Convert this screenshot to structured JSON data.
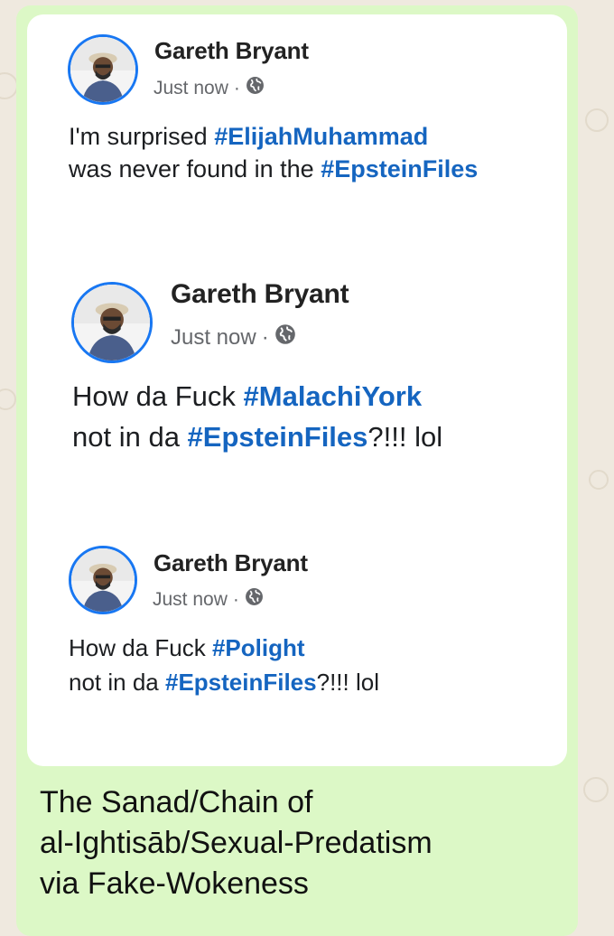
{
  "message": {
    "posts": [
      {
        "author": "Gareth Bryant",
        "time": "Just now",
        "separator": "·",
        "line1_text": "I'm surprised ",
        "line1_tag": "#ElijahMuhammad",
        "line2_text": "was never found in the ",
        "line2_tag": "#EpsteinFiles",
        "line2_suffix": ""
      },
      {
        "author": "Gareth Bryant",
        "time": "Just now",
        "separator": "·",
        "line1_text": "How da Fuck ",
        "line1_tag": "#MalachiYork",
        "line2_text": "not in da ",
        "line2_tag": "#EpsteinFiles",
        "line2_suffix": "?!!! lol"
      },
      {
        "author": "Gareth Bryant",
        "time": "Just now",
        "separator": "·",
        "line1_text": "How da Fuck ",
        "line1_tag": "#Polight",
        "line2_text": "not in da ",
        "line2_tag": "#EpsteinFiles",
        "line2_suffix": "?!!! lol"
      }
    ],
    "caption_lines": [
      "The Sanad/Chain of",
      "al-Ightisāb/Sexual-Predatism",
      "via Fake-Wokeness"
    ]
  },
  "colors": {
    "bubble": "#dcf8c6",
    "hashtag": "#1565c0",
    "avatar_ring": "#1877f2",
    "meta_gray": "#65676b"
  },
  "icons": [
    "globe-icon",
    "avatar-photo"
  ]
}
